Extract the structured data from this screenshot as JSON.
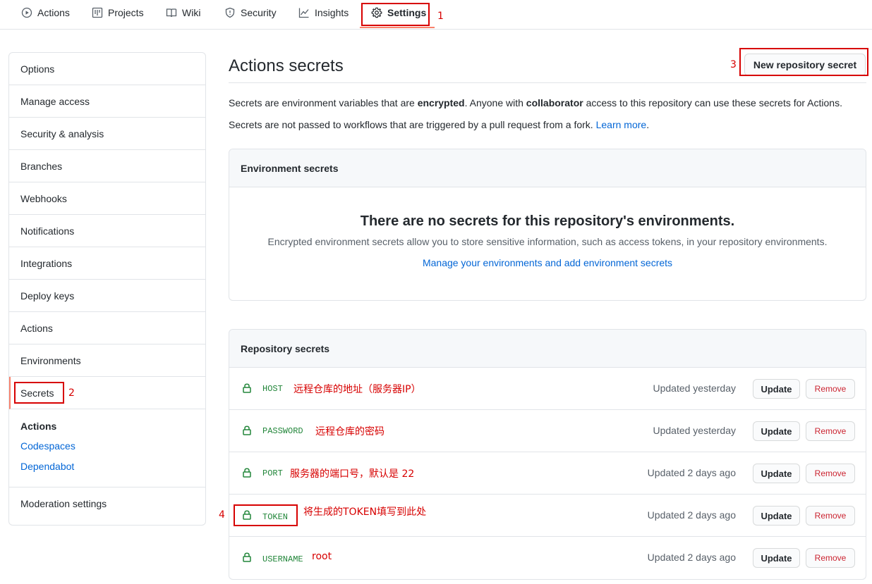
{
  "nav": {
    "tabs": [
      {
        "label": "Actions",
        "icon": "play-circle-icon"
      },
      {
        "label": "Projects",
        "icon": "project-board-icon"
      },
      {
        "label": "Wiki",
        "icon": "book-icon"
      },
      {
        "label": "Security",
        "icon": "shield-icon"
      },
      {
        "label": "Insights",
        "icon": "graph-icon"
      },
      {
        "label": "Settings",
        "icon": "gear-icon",
        "active": true
      }
    ]
  },
  "annotations": {
    "n1": "1",
    "n2": "2",
    "n3": "3",
    "n4": "4"
  },
  "sidebar": {
    "items": [
      "Options",
      "Manage access",
      "Security & analysis",
      "Branches",
      "Webhooks",
      "Notifications",
      "Integrations",
      "Deploy keys",
      "Actions",
      "Environments",
      "Secrets"
    ],
    "selected": "Secrets",
    "group": {
      "title": "Actions",
      "links": [
        "Codespaces",
        "Dependabot"
      ]
    },
    "footer_item": "Moderation settings"
  },
  "main": {
    "title": "Actions secrets",
    "new_button": "New repository secret",
    "desc1_part1": "Secrets are environment variables that are ",
    "desc1_bold1": "encrypted",
    "desc1_part2": ". Anyone with ",
    "desc1_bold2": "collaborator",
    "desc1_part3": " access to this repository can use these secrets for Actions.",
    "desc2_text": "Secrets are not passed to workflows that are triggered by a pull request from a fork. ",
    "desc2_link": "Learn more",
    "desc2_end": "."
  },
  "env_secrets": {
    "header": "Environment secrets",
    "blank_title": "There are no secrets for this repository's environments.",
    "blank_desc": "Encrypted environment secrets allow you to store sensitive information, such as access tokens, in your repository environments.",
    "blank_link": "Manage your environments and add environment secrets"
  },
  "repo_secrets": {
    "header": "Repository secrets",
    "update_label": "Update",
    "remove_label": "Remove",
    "rows": [
      {
        "name": "HOST",
        "note": "远程仓库的地址（服务器IP）",
        "updated": "Updated yesterday"
      },
      {
        "name": "PASSWORD",
        "note": "远程仓库的密码",
        "updated": "Updated yesterday"
      },
      {
        "name": "PORT",
        "note": "服务器的端口号，默认是 22",
        "updated": "Updated 2 days ago"
      },
      {
        "name": "TOKEN",
        "note": "将生成的TOKEN填写到此处",
        "updated": "Updated 2 days ago"
      },
      {
        "name": "USERNAME",
        "note": "root",
        "updated": "Updated 2 days ago"
      }
    ]
  },
  "colors": {
    "accent_underline": "#f9826c",
    "link": "#0366d6",
    "secret_name": "#22863a",
    "annotation_red": "#d70000",
    "remove_red": "#cb2431"
  }
}
